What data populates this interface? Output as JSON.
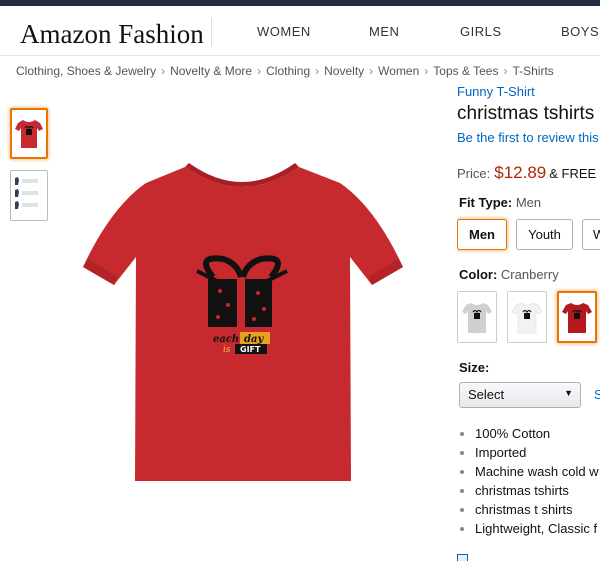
{
  "header": {
    "logo": "Amazon Fashion",
    "nav": [
      "WOMEN",
      "MEN",
      "GIRLS",
      "BOYS"
    ]
  },
  "breadcrumb": [
    "Clothing, Shoes & Jewelry",
    "Novelty & More",
    "Clothing",
    "Novelty",
    "Women",
    "Tops & Tees",
    "T-Shirts"
  ],
  "product": {
    "brand": "Funny T-Shirt",
    "title": "christmas tshirts",
    "review_link": "Be the first to review this",
    "price_label": "Price:",
    "price": "$12.89",
    "shipping": "& FREE",
    "design_text": {
      "line1a": "each",
      "line1b": "day",
      "line2a": "is",
      "line2b": "GIFT"
    },
    "fit_type": {
      "label": "Fit Type:",
      "selected": "Men",
      "options": [
        "Men",
        "Youth",
        "W"
      ]
    },
    "color": {
      "label": "Color:",
      "selected": "Cranberry",
      "swatch_colors": [
        "#cfcfcf",
        "#f2f2f2",
        "#b5191e"
      ]
    },
    "size": {
      "label": "Size:",
      "select_value": "Select",
      "chart_link": "S"
    },
    "bullets": [
      "100% Cotton",
      "Imported",
      "Machine wash cold w",
      "christmas tshirts",
      "christmas t shirts",
      "Lightweight, Classic f"
    ]
  },
  "colors": {
    "shirt": "#c62a2e",
    "accent_orange": "#e77600",
    "link": "#0066c0",
    "price": "#b12704"
  }
}
